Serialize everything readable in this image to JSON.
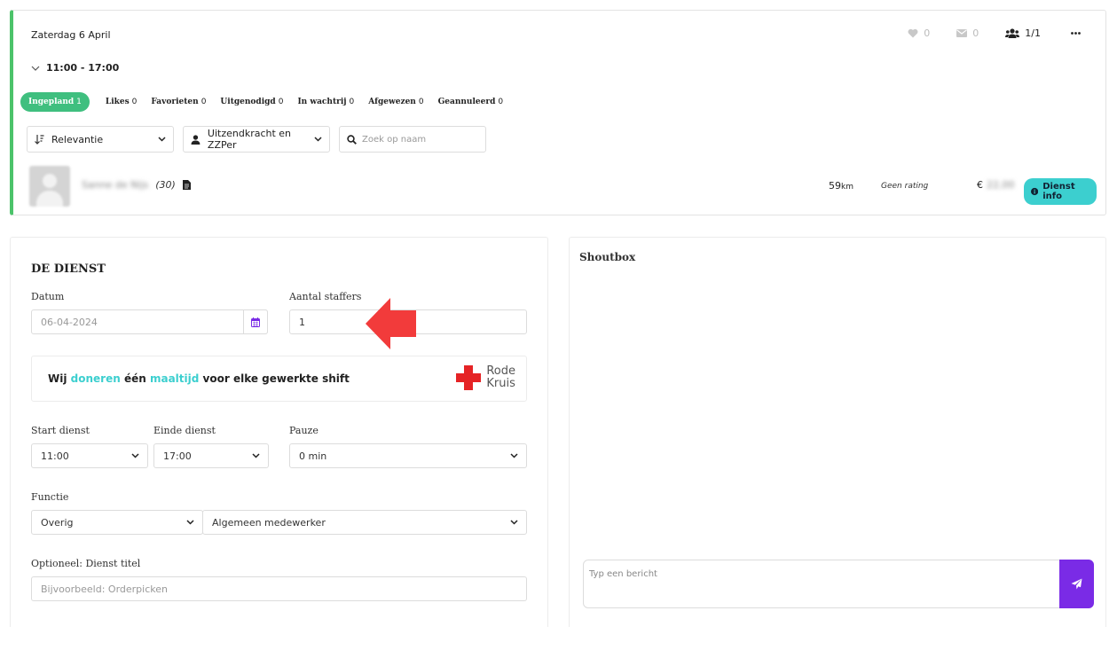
{
  "shift": {
    "date_title": "Zaterdag 6 April",
    "time_range": "11:00 - 17:00",
    "likes_count": "0",
    "messages_count": "0",
    "staff_count": "1/1"
  },
  "tabs": [
    {
      "label": "Ingepland",
      "count": "1",
      "active": true
    },
    {
      "label": "Likes",
      "count": "0"
    },
    {
      "label": "Favorieten",
      "count": "0"
    },
    {
      "label": "Uitgenodigd",
      "count": "0"
    },
    {
      "label": "In wachtrij",
      "count": "0"
    },
    {
      "label": "Afgewezen",
      "count": "0"
    },
    {
      "label": "Geannuleerd",
      "count": "0"
    }
  ],
  "filters": {
    "sort_value": "Relevantie",
    "type_value": "Uitzendkracht en ZZPer",
    "search_placeholder": "Zoek op naam"
  },
  "person": {
    "name": "Sanne de Nijs",
    "age": "(30)",
    "distance": "59",
    "distance_unit": "km",
    "rating": "Geen rating",
    "currency": "€",
    "price": "22,00",
    "info_label": "Dienst info"
  },
  "form": {
    "section_title": "DE DIENST",
    "date_label": "Datum",
    "date_value": "06-04-2024",
    "staff_label": "Aantal staffers",
    "staff_value": "1",
    "donate_pre": "Wij",
    "donate_hl1": "doneren",
    "donate_mid": "één",
    "donate_hl2": "maaltijd",
    "donate_post": "voor elke gewerkte shift",
    "redcross_line1": "Rode",
    "redcross_line2": "Kruis",
    "start_label": "Start dienst",
    "start_value": "11:00",
    "end_label": "Einde dienst",
    "end_value": "17:00",
    "pause_label": "Pauze",
    "pause_value": "0 min",
    "function_label": "Functie",
    "function_category": "Overig",
    "function_value": "Algemeen medewerker",
    "title_label": "Optioneel: Dienst titel",
    "title_placeholder": "Bijvoorbeeld: Orderpicken"
  },
  "shoutbox": {
    "title": "Shoutbox",
    "message_placeholder": "Typ een bericht"
  },
  "colors": {
    "accent_green": "#3fbf7f",
    "card_border_green": "#4cc36a",
    "teal": "#3ccfcf",
    "purple": "#7a2be6",
    "red_cross": "#e52325"
  }
}
